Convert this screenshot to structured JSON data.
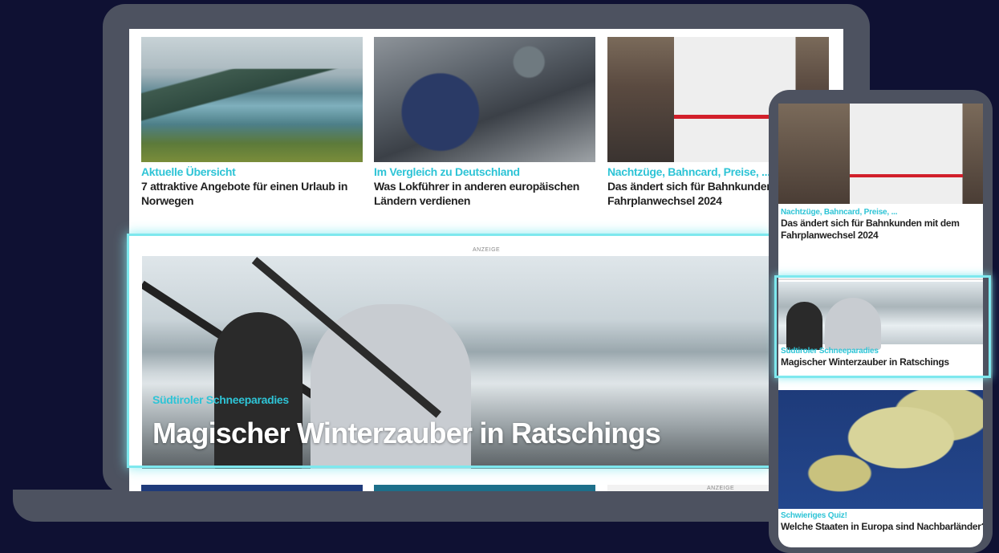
{
  "laptop": {
    "cards": [
      {
        "kicker": "Aktuelle Übersicht",
        "headline": "7 attraktive Angebote für einen Urlaub in Norwegen"
      },
      {
        "kicker": "Im Vergleich zu Deutschland",
        "headline": "Was Lokführer in anderen europäischen Ländern verdienen"
      },
      {
        "kicker": "Nachtzüge, Bahncard, Preise, ...",
        "headline": "Das ändert sich für Bahnkunden mit dem Fahrplanwechsel 2024"
      }
    ],
    "ad_label": "ANZEIGE",
    "hero": {
      "kicker": "Südtiroler Schneeparadies",
      "title": "Magischer Winterzauber in Ratschings"
    },
    "bottom_ad_label": "ANZEIGE"
  },
  "phone": {
    "cards": [
      {
        "kicker": "Nachtzüge, Bahncard, Preise, ...",
        "headline": "Das ändert sich für Bahnkunden mit dem Fahrplanwechsel 2024"
      },
      {
        "kicker": "Südtiroler Schneeparadies",
        "headline": "Magischer Winterzauber in Ratschings"
      },
      {
        "kicker": "Schwieriges Quiz!",
        "headline": "Welche Staaten in Europa sind Nachbarländer?"
      }
    ]
  },
  "colors": {
    "background": "#0f1133",
    "device": "#4d5260",
    "accent": "#2ec4d6",
    "highlight": "#7ee8ee"
  }
}
